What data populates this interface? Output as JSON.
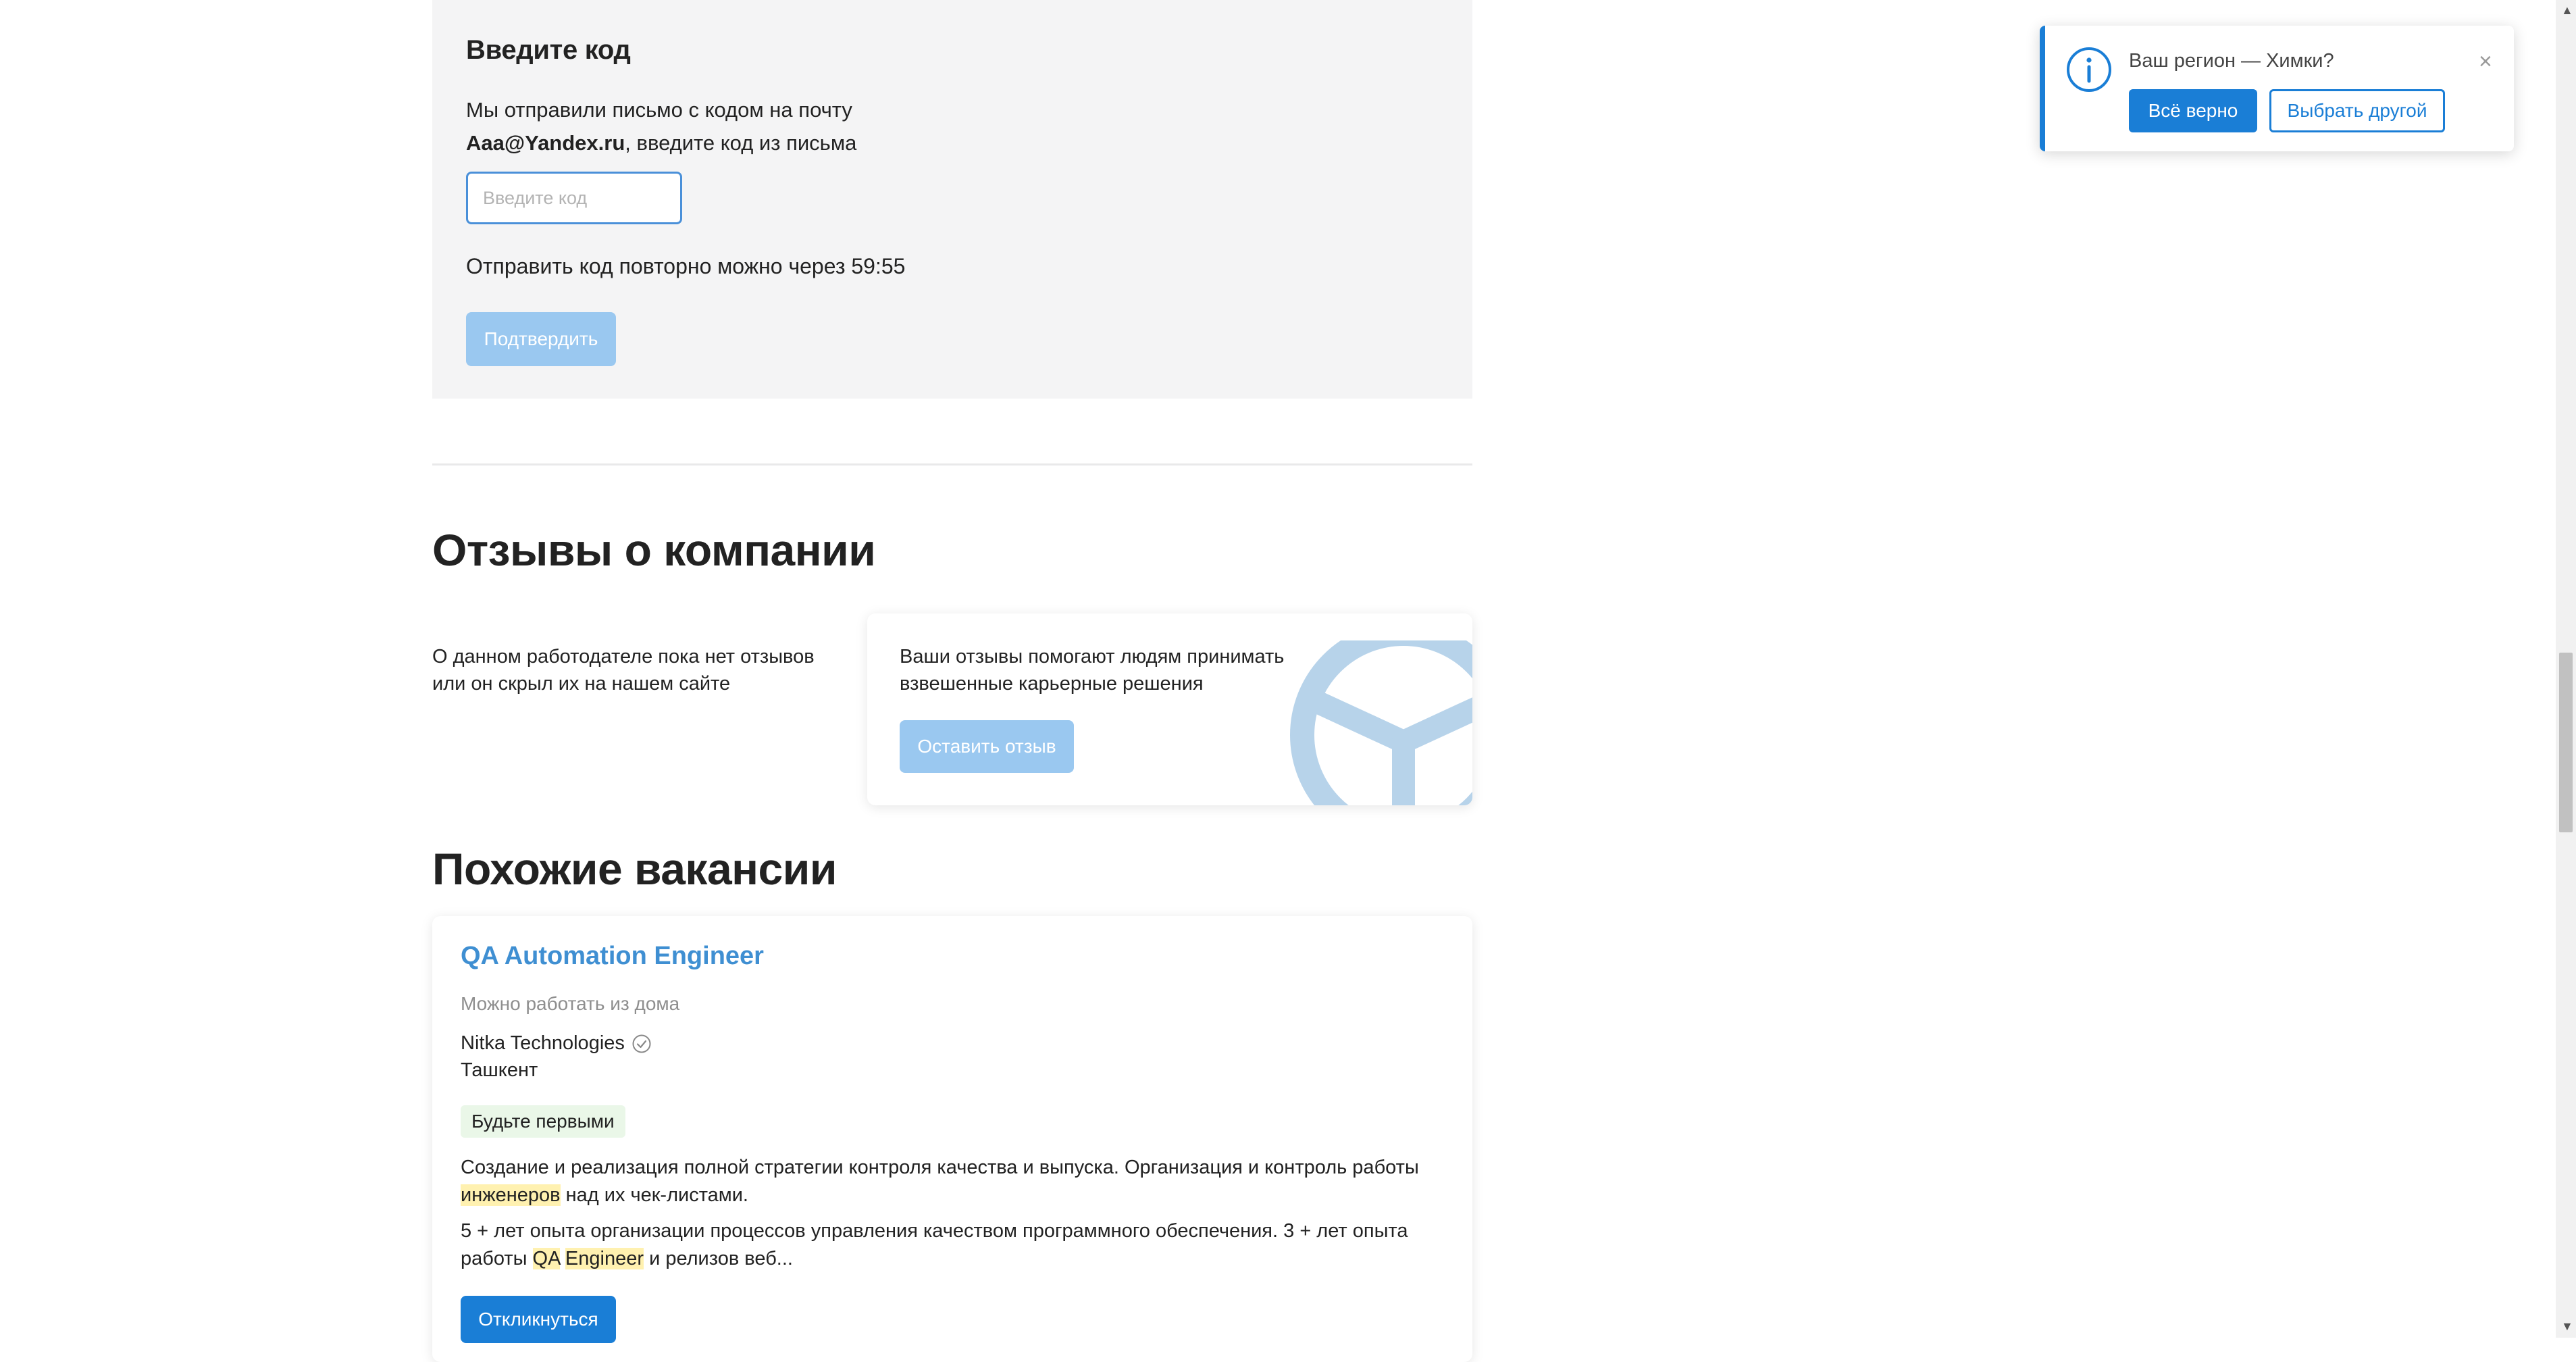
{
  "code_form": {
    "title": "Введите код",
    "line1": "Мы отправили письмо с кодом на почту",
    "email": "Aaa@Yandex.ru",
    "line2_rest": ", введите код из письма",
    "input_placeholder": "Введите код",
    "resend_text": "Отправить код повторно можно через 59:55",
    "confirm_label": "Подтвердить"
  },
  "reviews": {
    "heading": "Отзывы о компании",
    "empty_line1": "О данном работодателе пока нет отзывов",
    "empty_line2": "или он скрыл их на нашем сайте",
    "card_line1": "Ваши отзывы помогают людям принимать",
    "card_line2": "взвешенные карьерные решения",
    "leave_label": "Оставить отзыв"
  },
  "similar": {
    "heading": "Похожие вакансии",
    "vacancy": {
      "title": "QA Automation Engineer",
      "remote": "Можно работать из дома",
      "company": "Nitka Technologies",
      "city": "Ташкент",
      "badge": "Будьте первыми",
      "desc1_a": "Создание и реализация полной стратегии контроля качества и выпуска. Организация и контроль работы ",
      "desc1_hl": "инженеров",
      "desc1_b": " над их чек-листами.",
      "desc2_a": "5 + лет опыта организации процессов управления качеством программного обеспечения. 3 + лет опыта работы ",
      "desc2_hl1": "QA",
      "desc2_hl2": "Engineer",
      "desc2_b": " и релизов веб...",
      "apply_label": "Откликнуться"
    }
  },
  "region_popup": {
    "question": "Ваш регион — Химки?",
    "yes_label": "Всё верно",
    "other_label": "Выбрать другой",
    "close_glyph": "×"
  },
  "scrollbar": {
    "up_glyph": "▲",
    "down_glyph": "▼"
  },
  "colors": {
    "accent": "#1a7ed6",
    "link": "#3f8fd2",
    "disabled_button": "#9ac8f0",
    "panel_bg": "#f4f4f5",
    "highlight": "#fff1b0"
  }
}
